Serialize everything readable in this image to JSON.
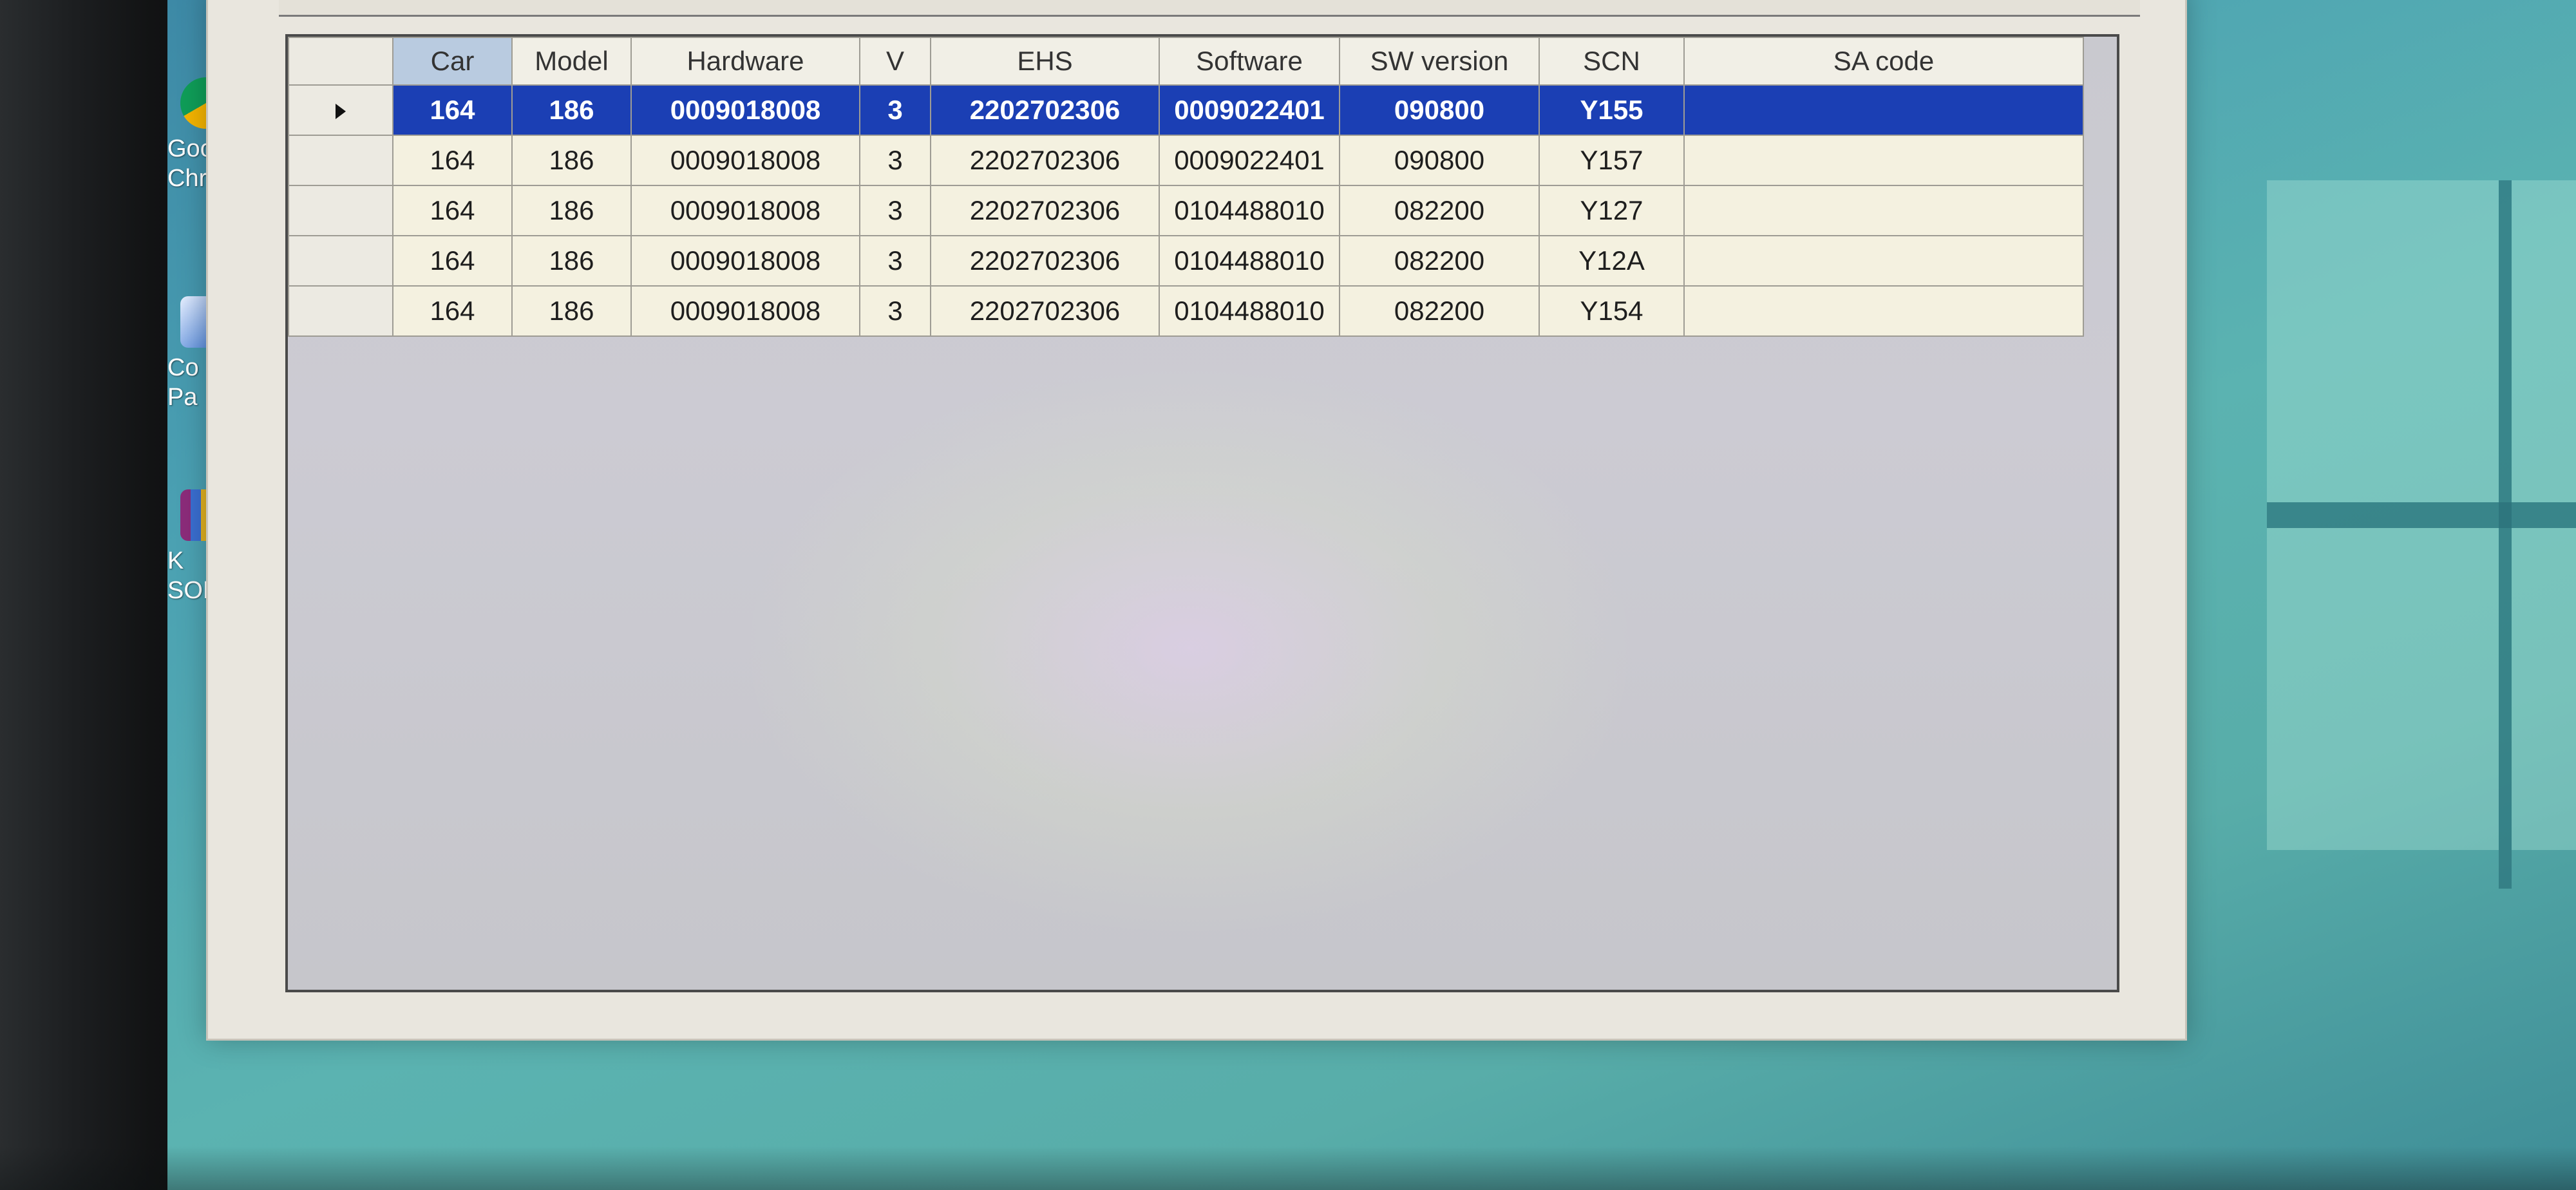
{
  "desktop": {
    "icons": [
      {
        "name": "chrome",
        "label_line1": "Goo",
        "label_line2": "Chr",
        "color": "#db4437"
      },
      {
        "name": "control-panel",
        "label_line1": "Co",
        "label_line2": "Pa",
        "color": "#2f6fd0"
      },
      {
        "name": "winrar",
        "label_line1": "K",
        "label_line2": "SORE",
        "color": "#8b2c7a"
      }
    ]
  },
  "grid": {
    "columns": [
      "",
      "Car",
      "Model",
      "Hardware",
      "V",
      "EHS",
      "Software",
      "SW version",
      "SCN",
      "SA code"
    ],
    "sorted_column": "Car",
    "selected_row": 0,
    "rows": [
      {
        "car": "164",
        "model": "186",
        "hardware": "0009018008",
        "v": "3",
        "ehs": "2202702306",
        "software": "0009022401",
        "sw_version": "090800",
        "scn": "Y155",
        "sa_code": ""
      },
      {
        "car": "164",
        "model": "186",
        "hardware": "0009018008",
        "v": "3",
        "ehs": "2202702306",
        "software": "0009022401",
        "sw_version": "090800",
        "scn": "Y157",
        "sa_code": ""
      },
      {
        "car": "164",
        "model": "186",
        "hardware": "0009018008",
        "v": "3",
        "ehs": "2202702306",
        "software": "0104488010",
        "sw_version": "082200",
        "scn": "Y127",
        "sa_code": ""
      },
      {
        "car": "164",
        "model": "186",
        "hardware": "0009018008",
        "v": "3",
        "ehs": "2202702306",
        "software": "0104488010",
        "sw_version": "082200",
        "scn": "Y12A",
        "sa_code": ""
      },
      {
        "car": "164",
        "model": "186",
        "hardware": "0009018008",
        "v": "3",
        "ehs": "2202702306",
        "software": "0104488010",
        "sw_version": "082200",
        "scn": "Y154",
        "sa_code": ""
      }
    ]
  },
  "colors": {
    "selection": "#1b3fb4",
    "row_background": "#f4f1e0",
    "sorted_header": "#b9cbe0"
  }
}
